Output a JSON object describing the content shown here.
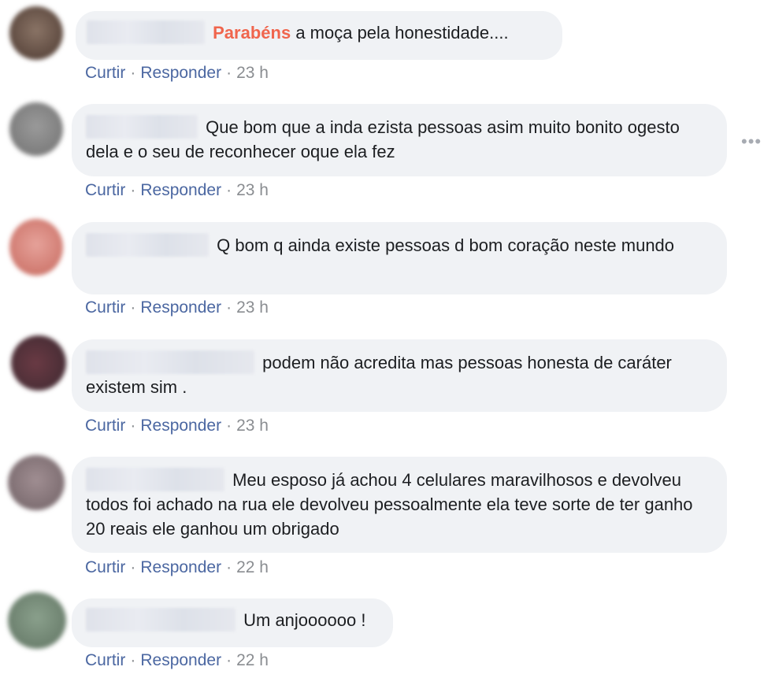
{
  "actions": {
    "like": "Curtir",
    "reply": "Responder",
    "separator": "·"
  },
  "more_icon": "•••",
  "comments": [
    {
      "highlight": "Parabéns",
      "text": "a moça pela honestidade....",
      "time": "23 h",
      "avatar_color": "#6e5a4e"
    },
    {
      "text": "Que bom que a inda ezista pessoas asim muito bonito ogesto dela e o seu de reconhecer oque ela fez",
      "time": "23 h",
      "avatar_color": "#8c8c8c"
    },
    {
      "text": "Q bom q ainda existe pessoas d bom coração neste mundo",
      "time": "23 h",
      "avatar_color": "#d98a80"
    },
    {
      "text": "podem não acredita mas pessoas honesta de caráter existem sim .",
      "time": "23 h",
      "avatar_color": "#5a3a44"
    },
    {
      "text": "Meu esposo já achou 4 celulares maravilhosos e devolveu todos foi achado na rua ele devolveu pessoalmente ela teve sorte de ter ganho 20 reais ele ganhou um obrigado",
      "time": "22 h",
      "avatar_color": "#8a7a7e"
    },
    {
      "text": "Um anjoooooo !",
      "time": "22 h",
      "avatar_color": "#7a9080"
    }
  ]
}
